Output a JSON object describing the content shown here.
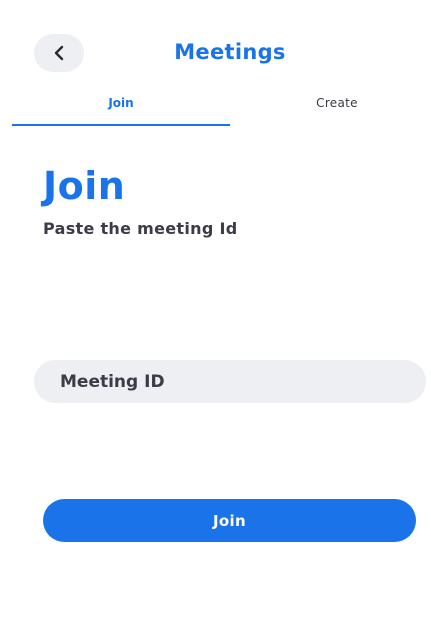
{
  "header": {
    "title": "Meetings",
    "back_icon": "chevron-left-icon"
  },
  "tabs": [
    {
      "label": "Join",
      "active": true
    },
    {
      "label": "Create",
      "active": false
    }
  ],
  "main": {
    "title": "Join",
    "subtitle": "Paste the meeting Id",
    "meeting_input": {
      "value": "",
      "placeholder": "Meeting ID"
    },
    "join_button_label": "Join"
  },
  "colors": {
    "accent": "#1a73e8",
    "field_background": "#eeeff3",
    "text_dark": "#3c3c48"
  }
}
